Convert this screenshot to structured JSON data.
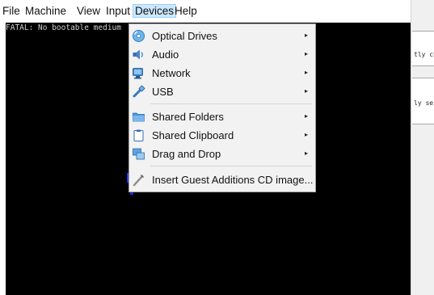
{
  "menubar": {
    "items": [
      {
        "label": "File",
        "active": false
      },
      {
        "label": "Machine",
        "active": false
      },
      {
        "label": "View",
        "active": false
      },
      {
        "label": "Input",
        "active": false
      },
      {
        "label": "Devices",
        "active": true
      },
      {
        "label": "Help",
        "active": false
      }
    ]
  },
  "console": {
    "text": "FATAL: No bootable medium"
  },
  "right_pane": {
    "line1": "tly ch",
    "line2": "ly sel"
  },
  "devices_menu": {
    "items": [
      {
        "label": "Optical Drives",
        "icon": "optical-drive-icon",
        "submenu": true
      },
      {
        "label": "Audio",
        "icon": "audio-icon",
        "submenu": true
      },
      {
        "label": "Network",
        "icon": "network-icon",
        "submenu": true
      },
      {
        "label": "USB",
        "icon": "usb-icon",
        "submenu": true
      },
      {
        "label": "Shared Folders",
        "icon": "shared-folders-icon",
        "submenu": true
      },
      {
        "label": "Shared Clipboard",
        "icon": "shared-clipboard-icon",
        "submenu": true
      },
      {
        "label": "Drag and Drop",
        "icon": "drag-and-drop-icon",
        "submenu": true
      },
      {
        "label": "Insert Guest Additions CD image...",
        "icon": "guest-additions-cd-icon",
        "submenu": false
      }
    ],
    "submenu_arrow": "▸"
  },
  "colors": {
    "screen_bg": "#000000",
    "active_menu_bg": "#cce8ff",
    "menu_bg": "#f2f2f2"
  }
}
